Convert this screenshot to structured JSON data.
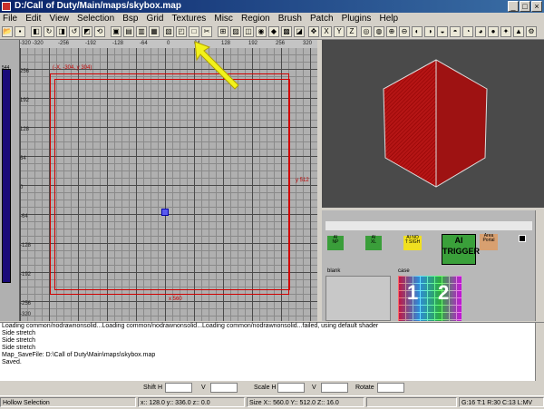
{
  "window": {
    "title": "D:/Call of Duty/Main/maps/skybox.map"
  },
  "menu": [
    "File",
    "Edit",
    "View",
    "Selection",
    "Bsp",
    "Grid",
    "Textures",
    "Misc",
    "Region",
    "Brush",
    "Patch",
    "Plugins",
    "Help"
  ],
  "grid_view": {
    "top_ticks": [
      "-320 -320",
      "-256",
      "-192",
      "-128",
      "-64",
      "0",
      "64",
      "128",
      "192",
      "256",
      "320"
    ],
    "left_ticks": [
      "256",
      "192",
      "128",
      "64",
      "0",
      "-64",
      "-128",
      "-192",
      "-256",
      "-320"
    ],
    "corner_label": "(-X, -304, y 304)",
    "right_label": "y 512",
    "bottom_label": "x 560",
    "side_label": "544"
  },
  "textures": {
    "top_row": [
      {
        "name": "ai-np",
        "label": "AI\nNP",
        "bg": "#3a9e3a"
      },
      {
        "name": "ai-xl",
        "label": "AI\nXL",
        "bg": "#3a9e3a"
      },
      {
        "name": "ai-no-sight",
        "label": "AI NO\nT SIGH",
        "bg": "#f0e020"
      },
      {
        "name": "ai-trigger",
        "label": "AI\nTRIGGER",
        "bg": "#3aa03a"
      },
      {
        "name": "area-portal",
        "label": "Area\nPortal",
        "bg": "#d8a070"
      }
    ],
    "blank_label": "blank",
    "case_label": "case",
    "case_numbers": [
      "1",
      "2"
    ]
  },
  "console": {
    "lines": [
      "Loading common/nodrawnonsolid...Loading common/nodrawnonsolid...Loading common/nodrawnonsolid...failed, using default shader",
      "Side stretch",
      "Side stretch",
      "Side stretch",
      "Map_SaveFile: D:\\Call of Duty\\Main\\maps\\skybox.map",
      "Saved."
    ]
  },
  "controls": {
    "shift_h": "Shift H",
    "v1": "V",
    "scale_h": "Scale H",
    "v2": "V",
    "rotate": "Rotate"
  },
  "status": {
    "mode": "Hollow Selection",
    "coords": "x:: 128.0  y:: 336.0  z:: 0.0",
    "size": "Size X:: 560.0  Y:: 512.0  Z:: 16.0",
    "grid": "G:16 T:1 R:30 C:13 L:MV"
  }
}
